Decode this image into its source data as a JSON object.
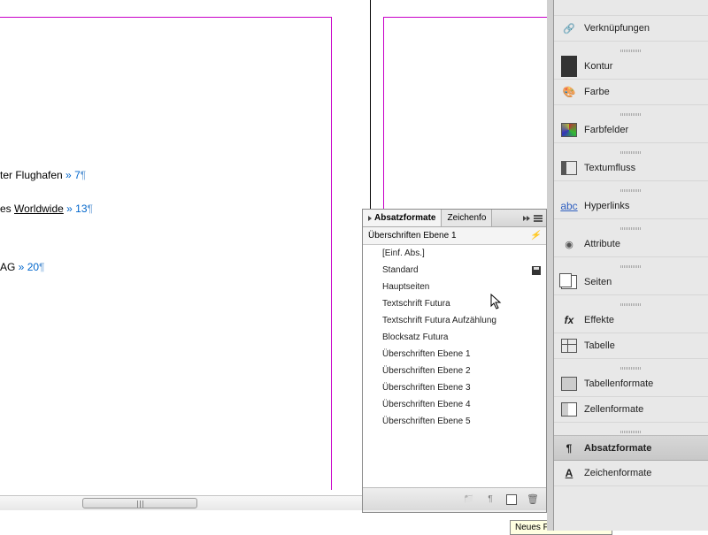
{
  "document": {
    "lines": [
      {
        "prefix": "ter Flughafen",
        "sep": " » ",
        "num": "7"
      },
      {
        "prefix": "es ",
        "uword": "Worldwide",
        "sep": " » ",
        "num": "13"
      },
      {
        "prefix": "AG   ",
        "sep": " »   ",
        "num": "20"
      }
    ],
    "pilcrow": "¶"
  },
  "paragraph_styles_panel": {
    "tabs": {
      "active": "Absatzformate",
      "other": "Zeichenfo"
    },
    "current": "Überschriften Ebene 1",
    "items": [
      {
        "label": "[Einf. Abs.]",
        "disk": false
      },
      {
        "label": "Standard",
        "disk": true
      },
      {
        "label": "Hauptseiten",
        "disk": false
      },
      {
        "label": "Textschrift Futura",
        "disk": false
      },
      {
        "label": "Textschrift Futura Aufzählung",
        "disk": false
      },
      {
        "label": "Blocksatz Futura",
        "disk": false
      },
      {
        "label": "Überschriften Ebene 1",
        "disk": false
      },
      {
        "label": "Überschriften Ebene 2",
        "disk": false
      },
      {
        "label": "Überschriften Ebene 3",
        "disk": false
      },
      {
        "label": "Überschriften Ebene 4",
        "disk": false
      },
      {
        "label": "Überschriften Ebene 5",
        "disk": false
      }
    ],
    "tooltip": "Neues Format erstellen"
  },
  "dock": {
    "groups": [
      {
        "items": [
          {
            "label": "",
            "icon": "",
            "cut": true
          },
          {
            "label": "Verknüpfungen",
            "icon": "ic-links"
          }
        ]
      },
      {
        "items": [
          {
            "label": "Kontur",
            "icon": "ic-stroke"
          },
          {
            "label": "Farbe",
            "icon": "ic-color"
          }
        ]
      },
      {
        "items": [
          {
            "label": "Farbfelder",
            "icon": "ic-swatch"
          }
        ]
      },
      {
        "items": [
          {
            "label": "Textumfluss",
            "icon": "ic-wrap"
          }
        ]
      },
      {
        "items": [
          {
            "label": "Hyperlinks",
            "icon": "ic-hyper",
            "iconText": "abc"
          }
        ]
      },
      {
        "items": [
          {
            "label": "Attribute",
            "icon": "ic-attr"
          }
        ]
      },
      {
        "items": [
          {
            "label": "Seiten",
            "icon": "ic-pages"
          }
        ]
      },
      {
        "items": [
          {
            "label": "Effekte",
            "icon": "ic-fx",
            "iconText": "fx"
          },
          {
            "label": "Tabelle",
            "icon": "ic-table"
          }
        ]
      },
      {
        "items": [
          {
            "label": "Tabellenformate",
            "icon": "ic-tfmt"
          },
          {
            "label": "Zellenformate",
            "icon": "ic-cfmt"
          }
        ]
      },
      {
        "items": [
          {
            "label": "Absatzformate",
            "icon": "ic-pfmt",
            "active": true
          },
          {
            "label": "Zeichenformate",
            "icon": "ic-cfont",
            "iconText": "A"
          }
        ]
      }
    ]
  }
}
